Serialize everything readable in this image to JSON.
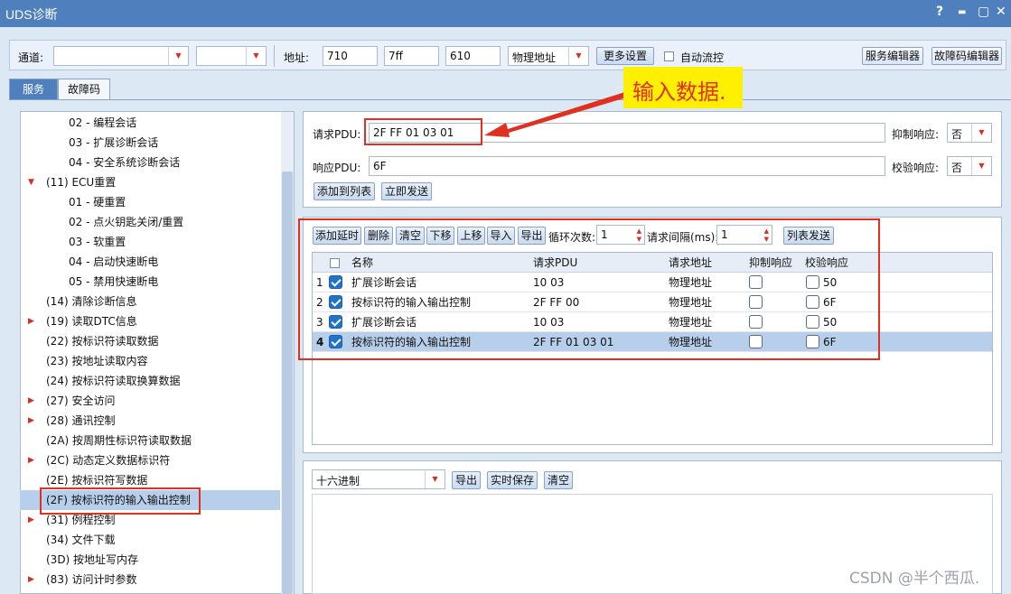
{
  "window": {
    "title": "UDS诊断",
    "controls": [
      "?",
      "▬",
      "▢",
      "✕"
    ]
  },
  "toolbar": {
    "channel_label": "通道:",
    "channel_value": "",
    "channel2_value": "",
    "address_label": "地址:",
    "addr1": "710",
    "addr2": "7ff",
    "addr3": "610",
    "addr_type": "物理地址",
    "more_settings": "更多设置",
    "auto_flow": "自动流控",
    "service_editor": "服务编辑器",
    "dtc_editor": "故障码编辑器"
  },
  "tabs": {
    "service": "服务",
    "dtc": "故障码"
  },
  "tree": [
    {
      "label": "02 - 编程会话",
      "indent": 2,
      "arrow": ""
    },
    {
      "label": "03 - 扩展诊断会话",
      "indent": 2,
      "arrow": ""
    },
    {
      "label": "04 - 安全系统诊断会话",
      "indent": 2,
      "arrow": ""
    },
    {
      "label": "(11) ECU重置",
      "indent": 1,
      "arrow": "▼"
    },
    {
      "label": "01 - 硬重置",
      "indent": 2,
      "arrow": ""
    },
    {
      "label": "02 - 点火钥匙关闭/重置",
      "indent": 2,
      "arrow": ""
    },
    {
      "label": "03 - 软重置",
      "indent": 2,
      "arrow": ""
    },
    {
      "label": "04 - 启动快速断电",
      "indent": 2,
      "arrow": ""
    },
    {
      "label": "05 - 禁用快速断电",
      "indent": 2,
      "arrow": ""
    },
    {
      "label": "(14) 清除诊断信息",
      "indent": 1,
      "arrow": ""
    },
    {
      "label": "(19) 读取DTC信息",
      "indent": 1,
      "arrow": "▶"
    },
    {
      "label": "(22) 按标识符读取数据",
      "indent": 1,
      "arrow": ""
    },
    {
      "label": "(23) 按地址读取内容",
      "indent": 1,
      "arrow": ""
    },
    {
      "label": "(24) 按标识符读取换算数据",
      "indent": 1,
      "arrow": ""
    },
    {
      "label": "(27) 安全访问",
      "indent": 1,
      "arrow": "▶"
    },
    {
      "label": "(28) 通讯控制",
      "indent": 1,
      "arrow": "▶"
    },
    {
      "label": "(2A) 按周期性标识符读取数据",
      "indent": 1,
      "arrow": ""
    },
    {
      "label": "(2C) 动态定义数据标识符",
      "indent": 1,
      "arrow": "▶"
    },
    {
      "label": "(2E) 按标识符写数据",
      "indent": 1,
      "arrow": ""
    },
    {
      "label": "(2F) 按标识符的输入输出控制",
      "indent": 1,
      "arrow": ""
    },
    {
      "label": "(31) 例程控制",
      "indent": 1,
      "arrow": "▶"
    },
    {
      "label": "(34) 文件下载",
      "indent": 1,
      "arrow": ""
    },
    {
      "label": "(3D) 按地址写内存",
      "indent": 1,
      "arrow": ""
    },
    {
      "label": "(83) 访问计时参数",
      "indent": 1,
      "arrow": "▶"
    }
  ],
  "request": {
    "req_label": "请求PDU:",
    "req_value": "2F FF 01 03 01",
    "suppress_label": "抑制响应:",
    "suppress_value": "否",
    "resp_label": "响应PDU:",
    "resp_value": "6F",
    "verify_label": "校验响应:",
    "verify_value": "否",
    "add_to_list": "添加到列表",
    "send_now": "立即发送"
  },
  "annotation": "输入数据.",
  "list_toolbar": {
    "add_delay": "添加延时",
    "delete": "删除",
    "clear": "清空",
    "move_down": "下移",
    "move_up": "上移",
    "import": "导入",
    "export": "导出",
    "loop_label": "循环次数:",
    "loop_value": "1",
    "interval_label": "请求间隔(ms):",
    "interval_value": "1",
    "list_send": "列表发送"
  },
  "table": {
    "headers": [
      "名称",
      "请求PDU",
      "请求地址",
      "抑制响应",
      "校验响应"
    ],
    "rows": [
      {
        "num": "1",
        "name": "扩展诊断会话",
        "pdu": "10 03",
        "addr": "物理地址",
        "verify": "50"
      },
      {
        "num": "2",
        "name": "按标识符的输入输出控制",
        "pdu": "2F FF 00",
        "addr": "物理地址",
        "verify": "6F"
      },
      {
        "num": "3",
        "name": "扩展诊断会话",
        "pdu": "10 03",
        "addr": "物理地址",
        "verify": "50"
      },
      {
        "num": "4",
        "name": "按标识符的输入输出控制",
        "pdu": "2F FF 01 03 01",
        "addr": "物理地址",
        "verify": "6F"
      }
    ]
  },
  "log": {
    "format": "十六进制",
    "export": "导出",
    "realtime_save": "实时保存",
    "clear": "清空"
  },
  "watermark": "CSDN @半个西瓜."
}
